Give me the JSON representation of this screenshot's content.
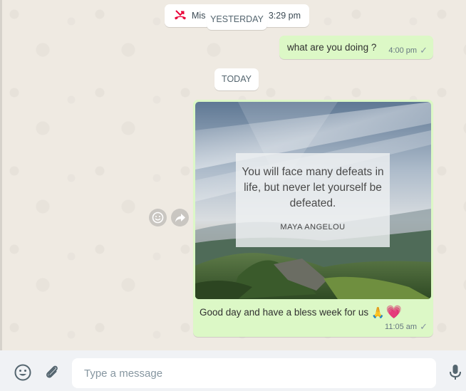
{
  "chat": {
    "missed_call": {
      "text": "Mis",
      "time": "3:29 pm",
      "icon": "missed-call-icon"
    },
    "date_yesterday": "YESTERDAY",
    "date_today": "TODAY",
    "messages": [
      {
        "type": "text",
        "text": "what are you doing ?",
        "time": "4:00 pm",
        "status": "sent"
      },
      {
        "type": "image",
        "image": {
          "quote": "You will face many defeats in life, but never let yourself be defeated.",
          "author": "MAYA ANGELOU"
        },
        "caption": "Good day and have a bless week for us",
        "caption_emojis": [
          "🙏",
          "💗"
        ],
        "time": "11:05 am",
        "status": "sent"
      }
    ],
    "hover_actions": [
      "react-icon",
      "forward-icon"
    ]
  },
  "composer": {
    "placeholder": "Type a message",
    "icons": [
      "emoji-icon",
      "attach-icon",
      "microphone-icon"
    ]
  },
  "colors": {
    "outgoing_bubble": "#dcf8c6",
    "background": "#efeae2",
    "missed_call_red": "#ea0038",
    "footer": "#f0f2f5"
  }
}
